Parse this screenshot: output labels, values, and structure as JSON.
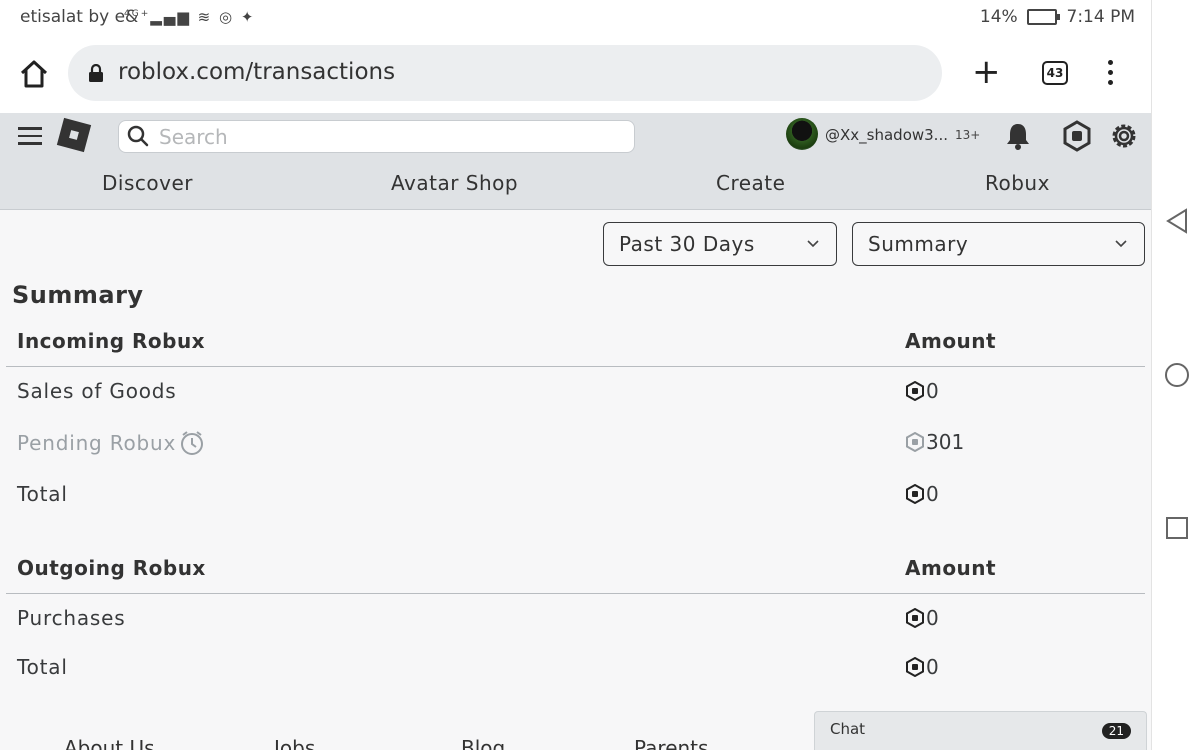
{
  "status_bar": {
    "carrier": "etisalat by e&",
    "network": "4G+",
    "battery": "14%",
    "time": "7:14 PM"
  },
  "browser": {
    "url": "roblox.com/transactions",
    "tab_count": "43"
  },
  "header": {
    "search_placeholder": "Search",
    "username": "@Xx_shadow3...",
    "age_badge": "13+",
    "nav": [
      "Discover",
      "Avatar Shop",
      "Create",
      "Robux"
    ]
  },
  "filters": {
    "period": "Past 30 Days",
    "view": "Summary"
  },
  "summary": {
    "title": "Summary",
    "incoming": {
      "header": "Incoming Robux",
      "amount_header": "Amount",
      "rows": [
        {
          "label": "Sales of Goods",
          "amount": "0"
        },
        {
          "label": "Pending Robux",
          "amount": "301"
        },
        {
          "label": "Total",
          "amount": "0"
        }
      ]
    },
    "outgoing": {
      "header": "Outgoing Robux",
      "amount_header": "Amount",
      "rows": [
        {
          "label": "Purchases",
          "amount": "0"
        },
        {
          "label": "Total",
          "amount": "0"
        }
      ]
    }
  },
  "footer": {
    "links": [
      "About Us",
      "Jobs",
      "Blog",
      "Parents"
    ]
  },
  "chat": {
    "label": "Chat",
    "count": "21"
  },
  "icons": {
    "home": "home-icon",
    "lock": "lock-icon",
    "search": "search-icon",
    "bell": "bell-icon",
    "robux": "robux-icon",
    "gear": "gear-icon",
    "pending": "clock-icon"
  },
  "colors": {
    "header_bg": "#dfe2e5",
    "page_bg": "#f7f7f8",
    "text": "#393b3d"
  }
}
